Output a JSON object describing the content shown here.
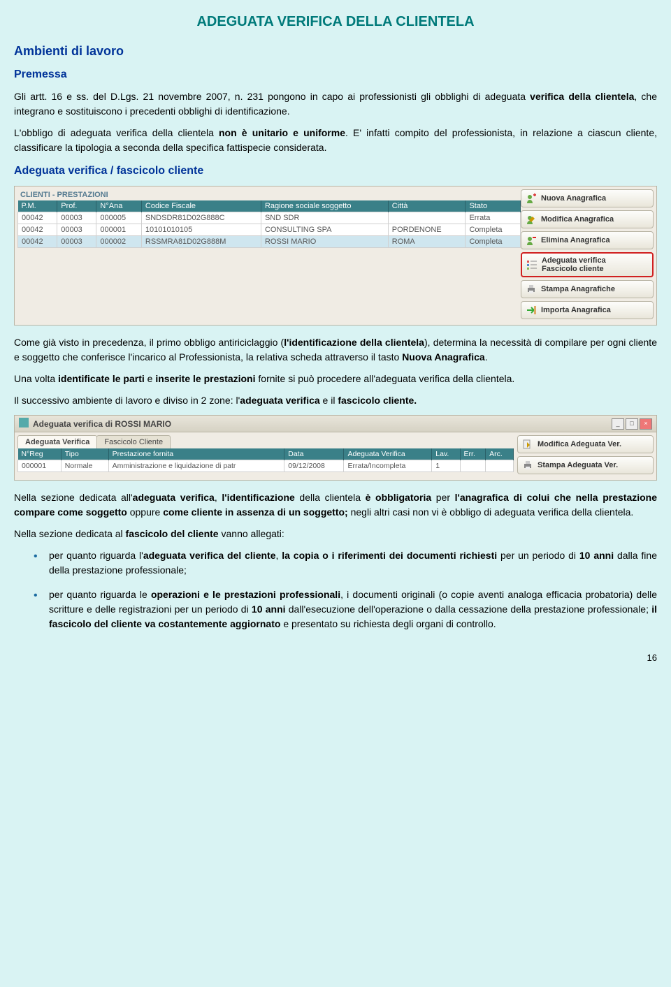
{
  "title": "ADEGUATA VERIFICA DELLA CLIENTELA",
  "headings": {
    "h2a": "Ambienti di lavoro",
    "h3a": "Premessa",
    "h3b": "Adeguata verifica / fascicolo cliente"
  },
  "para": {
    "p1a": "Gli artt. 16 e ss. del D.Lgs. 21 novembre 2007, n. 231 pongono in capo ai professionisti gli obblighi di adeguata ",
    "p1b": "verifica della clientela",
    "p1c": ", che integrano e sostituiscono i precedenti obblighi di identificazione.",
    "p2a": "L'obbligo di adeguata verifica della clientela ",
    "p2b": "non è unitario e uniforme",
    "p2c": ". E' infatti compito del professionista, in relazione a ciascun cliente,  classificare la tipologia a seconda della specifica fattispecie considerata.",
    "p3a": "Come già visto in precedenza, il primo obbligo antiriciclaggio (",
    "p3b": "l'identificazione della clientela",
    "p3c": "), determina la necessità di compilare per ogni cliente e soggetto che conferisce l'incarico al Professionista, la relativa scheda attraverso il tasto ",
    "p3d": "Nuova Anagrafica",
    "p3e": ".",
    "p4a": "Una volta ",
    "p4b": "identificate le parti",
    "p4c": " e ",
    "p4d": "inserite le prestazioni",
    "p4e": " fornite si può procedere all'adeguata verifica della clientela.",
    "p5a": "Il successivo ambiente di lavoro e diviso in 2 zone: l'",
    "p5b": "adeguata verifica",
    "p5c": " e il ",
    "p5d": "fascicolo cliente.",
    "p6a": "Nella sezione dedicata all'",
    "p6b": "adeguata verifica",
    "p6c": ", ",
    "p6d": "l'identificazione",
    "p6e": " della clientela ",
    "p6f": "è obbligatoria",
    "p6g": " per ",
    "p6h": "l'anagrafica di colui che nella prestazione compare come soggetto",
    "p6i": " oppure ",
    "p6j": "come cliente in assenza di un soggetto;",
    "p6k": " negli altri casi non vi è obbligo di adeguata verifica della clientela.",
    "p7a": "Nella sezione dedicata al ",
    "p7b": "fascicolo del cliente",
    "p7c": " vanno allegati:"
  },
  "bullets": {
    "b1a": "per quanto riguarda l'",
    "b1b": "adeguata verifica del cliente",
    "b1c": ", ",
    "b1d": "la copia o i riferimenti dei documenti richiesti",
    "b1e": " per un periodo di ",
    "b1f": "10 anni",
    "b1g": " dalla fine della prestazione professionale;",
    "b2a": "per quanto riguarda le ",
    "b2b": "operazioni e le prestazioni professionali",
    "b2c": ", i documenti originali (o copie aventi analoga efficacia probatoria) delle scritture e delle registrazioni per un periodo di ",
    "b2d": "10 anni",
    "b2e": " dall'esecuzione dell'operazione o dalla cessazione della prestazione professionale; ",
    "b2f": "il fascicolo del cliente va costantemente aggiornato",
    "b2g": " e presentato su richiesta degli organi di controllo."
  },
  "shot1": {
    "panel_title": "CLIENTI - PRESTAZIONI",
    "cols": {
      "c1": "P.M.",
      "c2": "Prof.",
      "c3": "N°Ana",
      "c4": "Codice Fiscale",
      "c5": "Ragione sociale soggetto",
      "c6": "Città",
      "c7": "Stato"
    },
    "rows": [
      {
        "c1": "00042",
        "c2": "00003",
        "c3": "000005",
        "c4": "SNDSDR81D02G888C",
        "c5": "SND SDR",
        "c6": "",
        "c7": "Errata"
      },
      {
        "c1": "00042",
        "c2": "00003",
        "c3": "000001",
        "c4": "10101010105",
        "c5": "CONSULTING SPA",
        "c6": "PORDENONE",
        "c7": "Completa"
      },
      {
        "c1": "00042",
        "c2": "00003",
        "c3": "000002",
        "c4": "RSSMRA81D02G888M",
        "c5": "ROSSI MARIO",
        "c6": "ROMA",
        "c7": "Completa"
      }
    ],
    "buttons": {
      "b1": "Nuova Anagrafica",
      "b2": "Modifica Anagrafica",
      "b3": "Elimina Anagrafica",
      "b4a": "Adeguata verifica",
      "b4b": "Fascicolo cliente",
      "b5": "Stampa Anagrafiche",
      "b6": "Importa Anagrafica"
    }
  },
  "shot2": {
    "win_title": "Adeguata verifica di ROSSI MARIO",
    "tab1": "Adeguata Verifica",
    "tab2": "Fascicolo Cliente",
    "cols": {
      "c1": "N°Reg",
      "c2": "Tipo",
      "c3": "Prestazione fornita",
      "c4": "Data",
      "c5": "Adeguata Verifica",
      "c6": "Lav.",
      "c7": "Err.",
      "c8": "Arc."
    },
    "row": {
      "c1": "000001",
      "c2": "Normale",
      "c3": "Amministrazione e liquidazione di patr",
      "c4": "09/12/2008",
      "c5": "Errata/Incompleta",
      "c6": "1",
      "c7": "",
      "c8": ""
    },
    "buttons": {
      "b1": "Modifica Adeguata Ver.",
      "b2": "Stampa Adeguata Ver."
    }
  },
  "page_num": "16"
}
